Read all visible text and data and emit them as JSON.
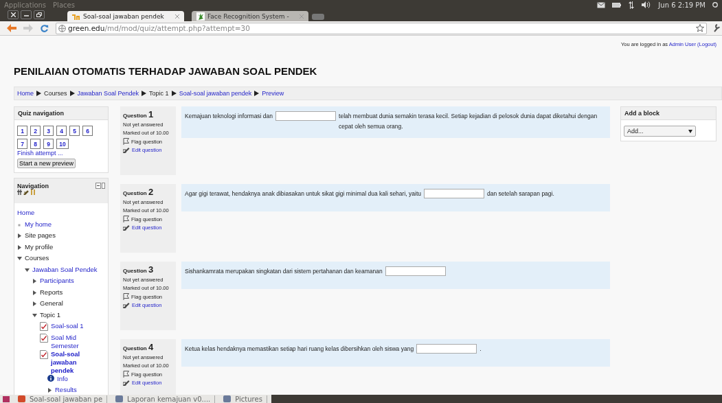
{
  "top_panel": {
    "menus": [
      "Applications",
      "Places"
    ],
    "clock": "Jun 6 2:19 PM"
  },
  "browser": {
    "tabs": [
      {
        "title": "Soal-soal jawaban pendek",
        "selected": true
      },
      {
        "title": "Face Recognition System -",
        "selected": false
      }
    ],
    "url_host": "green.edu",
    "url_path": "/md/mod/quiz/attempt.php?attempt=30"
  },
  "header": {
    "title": "PENILAIAN OTOMATIS TERHADAP JAWABAN SOAL PENDEK",
    "login_text": "You are logged in as",
    "login_user": "Admin User",
    "logout": "(Logout)"
  },
  "breadcrumb": [
    {
      "label": "Home",
      "link": true
    },
    {
      "label": "Courses",
      "link": false
    },
    {
      "label": "Jawaban Soal Pendek",
      "link": true
    },
    {
      "label": "Topic 1",
      "link": false
    },
    {
      "label": "Soal-soal jawaban pendek",
      "link": true
    },
    {
      "label": "Preview",
      "link": true
    }
  ],
  "quiz_navigation": {
    "title": "Quiz navigation",
    "buttons": [
      "1",
      "2",
      "3",
      "4",
      "5",
      "6",
      "7",
      "8",
      "9",
      "10"
    ],
    "finish": "Finish attempt ...",
    "start_button": "Start a new preview"
  },
  "navigation": {
    "title": "Navigation",
    "items": [
      {
        "label": "Home",
        "kind": "plain",
        "link": true,
        "selected": false
      },
      {
        "label": "My home",
        "kind": "bullet",
        "link": true,
        "selected": false
      },
      {
        "label": "Site pages",
        "kind": "branch",
        "expanded": false,
        "link": false,
        "selected": false
      },
      {
        "label": "My profile",
        "kind": "branch",
        "expanded": false,
        "link": false,
        "selected": false
      },
      {
        "label": "Courses",
        "kind": "branch",
        "expanded": true,
        "link": false,
        "selected": false,
        "children": [
          {
            "label": "Jawaban Soal Pendek",
            "kind": "branch",
            "expanded": true,
            "link": true,
            "selected": false,
            "children": [
              {
                "label": "Participants",
                "kind": "branch",
                "expanded": false,
                "link": true,
                "selected": false
              },
              {
                "label": "Reports",
                "kind": "branch",
                "expanded": false,
                "link": false,
                "selected": false
              },
              {
                "label": "General",
                "kind": "branch",
                "expanded": false,
                "link": false,
                "selected": false
              },
              {
                "label": "Topic 1",
                "kind": "branch",
                "expanded": true,
                "link": false,
                "selected": false,
                "children": [
                  {
                    "label": "Soal-soal 1",
                    "kind": "quiz",
                    "link": true,
                    "selected": false
                  },
                  {
                    "label": "Soal Mid Semester",
                    "kind": "quiz",
                    "link": true,
                    "selected": false
                  },
                  {
                    "label": "Soal-soal jawaban pendek",
                    "kind": "quiz",
                    "link": true,
                    "selected": true,
                    "children": [
                      {
                        "label": "Info",
                        "kind": "info",
                        "link": true,
                        "selected": false
                      },
                      {
                        "label": "Results",
                        "kind": "branch",
                        "expanded": false,
                        "link": true,
                        "selected": false
                      }
                    ]
                  }
                ]
              }
            ]
          }
        ]
      }
    ]
  },
  "questions": [
    {
      "label": "Question",
      "number": "1",
      "status": "Not yet answered",
      "marked": "Marked out of 10.00",
      "flag": "Flag question",
      "edit": "Edit question",
      "before": "Kemajuan teknologi informasi dan",
      "after": "telah membuat dunia semakin terasa kecil. Setiap kejadian di pelosok dunia dapat diketahui dengan cepat oleh semua orang."
    },
    {
      "label": "Question",
      "number": "2",
      "status": "Not yet answered",
      "marked": "Marked out of 10.00",
      "flag": "Flag question",
      "edit": "Edit question",
      "before": "Agar gigi terawat, hendaknya anak dibiasakan untuk sikat gigi minimal dua kali sehari, yaitu",
      "after": "dan setelah sarapan pagi."
    },
    {
      "label": "Question",
      "number": "3",
      "status": "Not yet answered",
      "marked": "Marked out of 10.00",
      "flag": "Flag question",
      "edit": "Edit question",
      "before": "Sishankamrata merupakan singkatan dari sistem pertahanan dan keamanan"
    },
    {
      "label": "Question",
      "number": "4",
      "status": "Not yet answered",
      "marked": "Marked out of 10.00",
      "flag": "Flag question",
      "edit": "Edit question",
      "before": "Ketua kelas hendaknya memastikan setiap hari ruang kelas dibersihkan oleh siswa yang",
      "after": "."
    }
  ],
  "add_block": {
    "title": "Add a block",
    "select": "Add..."
  },
  "taskbar": [
    "Soal-soal jawaban pe",
    "Laporan kemajuan v0....",
    "Pictures"
  ]
}
